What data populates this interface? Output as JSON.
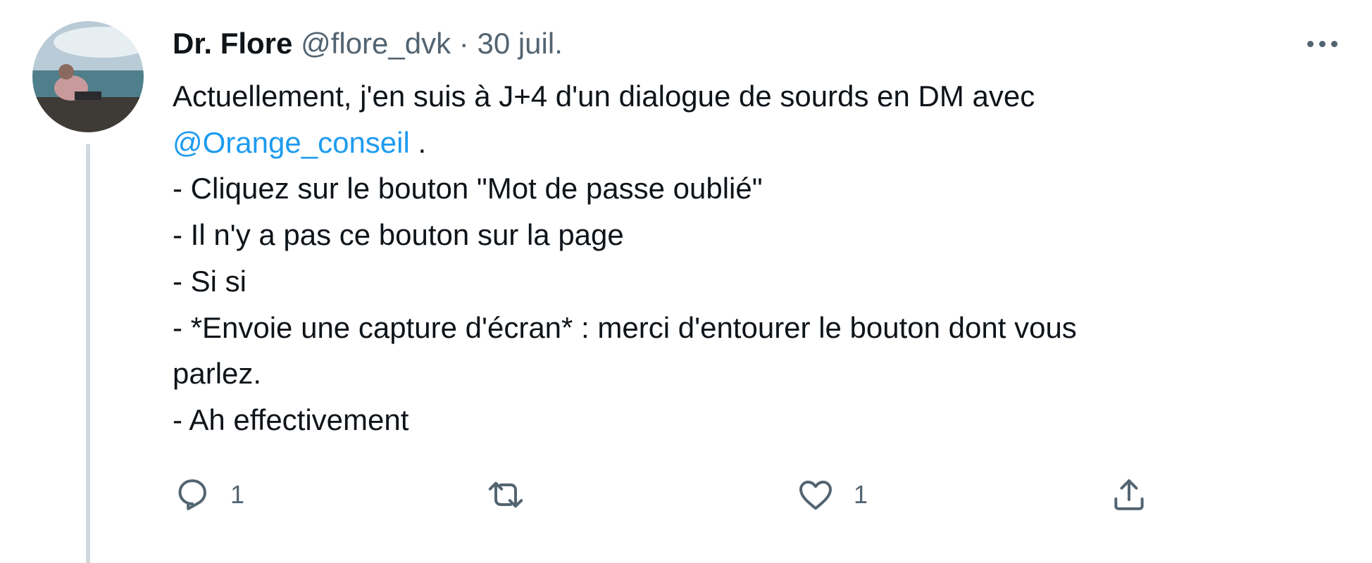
{
  "tweet": {
    "author": {
      "display_name": "Dr. Flore",
      "handle": "@flore_dvk",
      "separator": "·",
      "date": "30 juil."
    },
    "text_lines": {
      "l1": "Actuellement, j'en suis à J+4 d'un dialogue de sourds en DM avec",
      "mention": "@Orange_conseil",
      "l2_suffix": " .",
      "l3": "- Cliquez sur le bouton \"Mot de passe oublié\"",
      "l4": "- Il n'y a pas ce bouton sur la page",
      "l5": "- Si si",
      "l6": "- *Envoie une capture d'écran* : merci d'entourer le bouton dont vous",
      "l7": "parlez.",
      "l8": "- Ah effectivement"
    },
    "actions": {
      "reply_count": "1",
      "retweet_count": "",
      "like_count": "1"
    },
    "icons": {
      "more": "more-horizontal-icon",
      "reply": "reply-icon",
      "retweet": "retweet-icon",
      "like": "heart-icon",
      "share": "share-icon"
    },
    "colors": {
      "text": "#0f1419",
      "secondary": "#536471",
      "link": "#1d9bf0",
      "thread_line": "#cfd9de"
    }
  }
}
